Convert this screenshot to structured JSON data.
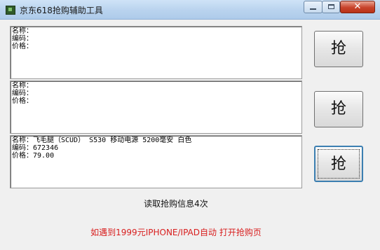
{
  "window": {
    "title": "京东618抢购辅助工具",
    "buttons": {
      "minimize": "–",
      "maximize": "□",
      "close": "✕"
    }
  },
  "labels": {
    "name": "名称：",
    "code": "编码：",
    "price": "价格："
  },
  "products": [
    {
      "name": "",
      "code": "",
      "price": ""
    },
    {
      "name": "",
      "code": "",
      "price": ""
    },
    {
      "name": "飞毛腿（SCUD） S530 移动电源 5200毫安 白色",
      "code": "672346",
      "price": "79.00"
    }
  ],
  "grab_buttons": [
    "抢",
    "抢",
    "抢"
  ],
  "status": {
    "read_count": "读取抢购信息4次",
    "rule": "如遇到1999元IPHONE/IPAD自动 打开抢购页"
  },
  "colors": {
    "rule_text": "#d81e1e",
    "title_bar": "#b9d3ee",
    "close_button": "#c8432b"
  }
}
